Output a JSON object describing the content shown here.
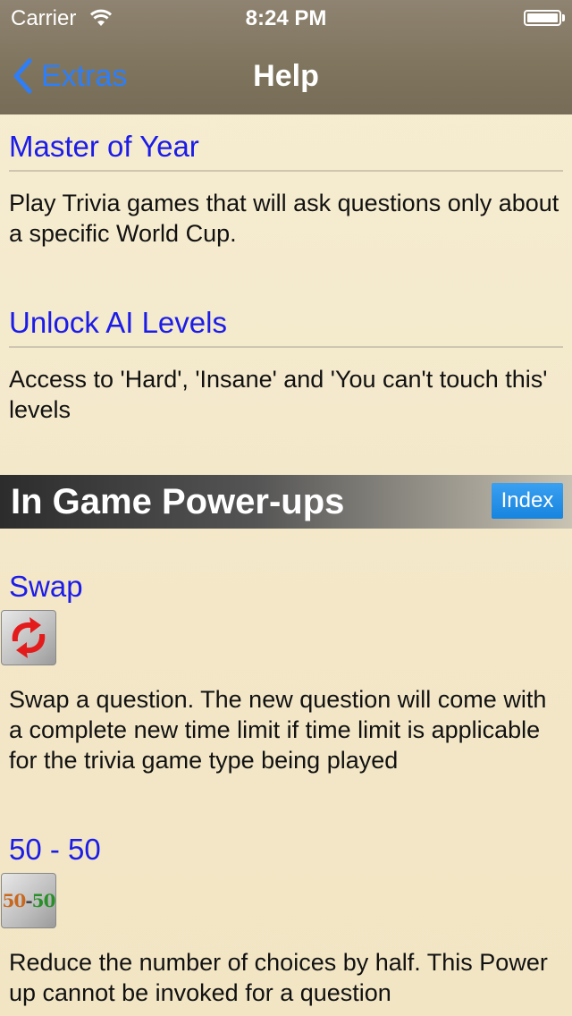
{
  "status_bar": {
    "carrier": "Carrier",
    "time": "8:24 PM"
  },
  "nav": {
    "back_label": "Extras",
    "title": "Help"
  },
  "entries_top": [
    {
      "title": "Master of Year",
      "description": "Play Trivia games that will ask questions only about a specific World Cup."
    },
    {
      "title": "Unlock AI Levels",
      "description": "Access to 'Hard', 'Insane' and 'You can't touch this' levels"
    }
  ],
  "section": {
    "title": "In Game Power-ups",
    "index_label": "Index"
  },
  "powerups": [
    {
      "title": "Swap",
      "icon": "swap-icon",
      "description": "Swap a question. The new question will come with a complete new time limit if time limit is applicable for the trivia game type being played"
    },
    {
      "title": "50 - 50",
      "icon": "fifty-fifty-icon",
      "icon_text": "50-50",
      "description": "Reduce the number of choices by half. This Power up cannot be invoked for a question"
    }
  ],
  "colors": {
    "link_blue": "#1c1ce8",
    "nav_blue": "#2d7ef7",
    "index_blue": "#1784df"
  }
}
